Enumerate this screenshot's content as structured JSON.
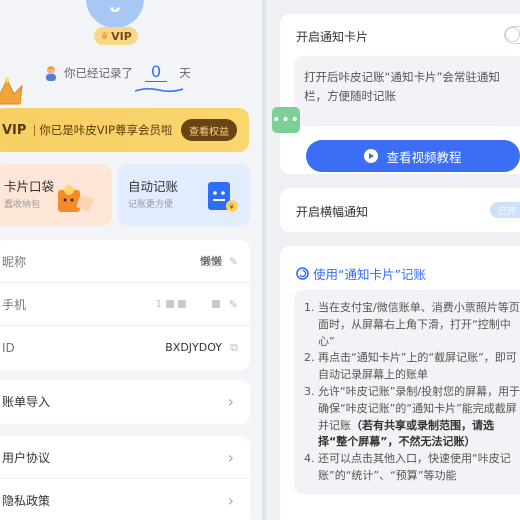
{
  "profile": {
    "vip_badge": "VIP",
    "recorded_prefix": "你已经记录了",
    "recorded_days": "0",
    "recorded_suffix": "天"
  },
  "vip_banner": {
    "vip": "VIP",
    "separator": "|",
    "text": "你已是咔皮VIP尊享会员啦",
    "button": "查看权益"
  },
  "cards": [
    {
      "title": "卡片口袋",
      "subtitle": "蠢收纳包"
    },
    {
      "title": "自动记账",
      "subtitle": "记账更方便"
    }
  ],
  "account": {
    "nickname_label": "昵称",
    "nickname_value": "懒懒",
    "phone_label": "手机",
    "phone_value": "1",
    "id_label": "ID",
    "id_value": "BXDJYDOY"
  },
  "menu": {
    "import": "账单导入",
    "agreement": "用户协议",
    "privacy": "隐私政策"
  },
  "notify": {
    "title": "开启通知卡片",
    "description": "打开后咔皮记账“通知卡片”会常驻通知栏，方便随时记账",
    "video_button": "查看视频教程",
    "banner_title": "开启横幅通知",
    "banner_button": "已开"
  },
  "guide": {
    "title": "使用“通知卡片”记账",
    "steps": [
      {
        "n": "1.",
        "text": "当在支付宝/微信账单、消费小票照片等页面时，从屏幕右上角下滑，打开“控制中心”"
      },
      {
        "n": "2.",
        "text": "再点击“通知卡片”上的“截屏记账”，即可自动记录屏幕上的账单"
      },
      {
        "n": "3.",
        "text": "允许“咔皮记账”录制/投射您的屏幕，用于确保“咔皮记账”的“通知卡片”能完成截屏并记账",
        "bold": "（若有共享或录制范围，请选择“整个屏幕”，不然无法记账）"
      },
      {
        "n": "4.",
        "text": "还可以点击其他入口，快速使用“咔皮记账”的“统计”、“预算”等功能"
      }
    ]
  },
  "colors": {
    "accent": "#3b6ef5",
    "vip_gold": "#f7cf63",
    "float_green": "#7ccf96"
  }
}
